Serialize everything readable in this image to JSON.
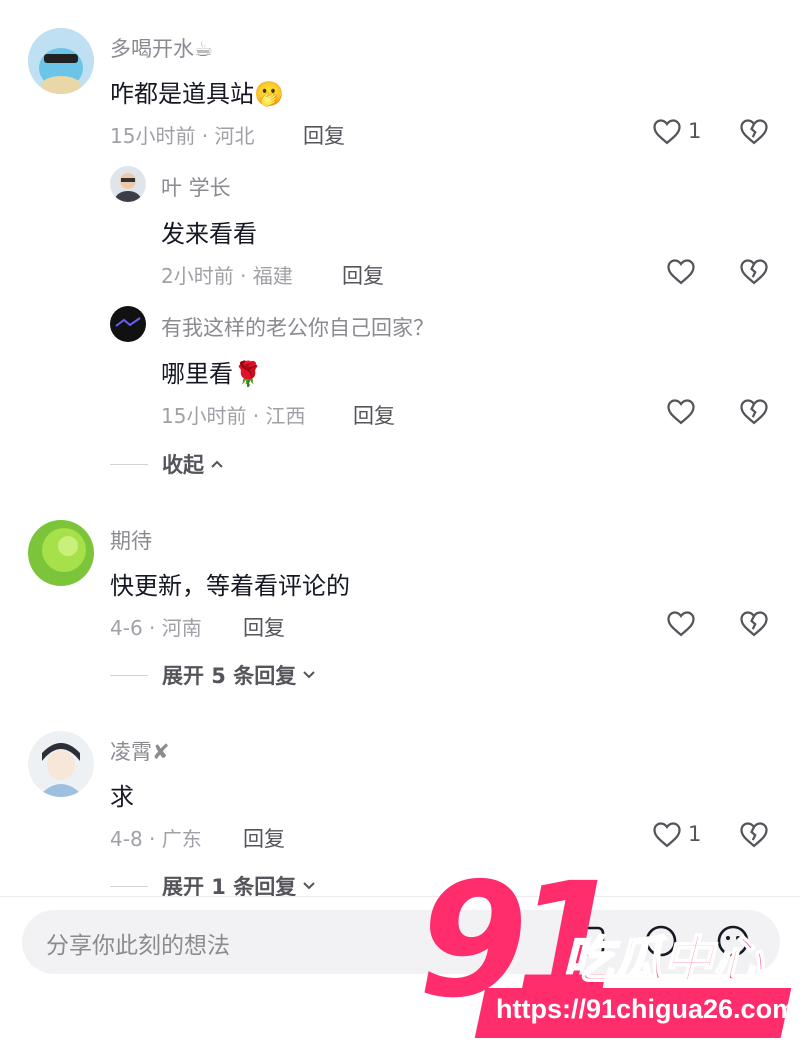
{
  "comments": [
    {
      "username": "多喝开水☕",
      "text": "咋都是道具站🫢",
      "time_location": "15小时前 · 河北",
      "reply_label": "回复",
      "like_count": "1",
      "replies": [
        {
          "username": "叶 学长",
          "text": "发来看看",
          "time_location": "2小时前 · 福建",
          "reply_label": "回复"
        },
        {
          "username": "有我这样的老公你自己回家？",
          "text": "哪里看🌹",
          "time_location": "15小时前 · 江西",
          "reply_label": "回复"
        }
      ],
      "collapse_label": "收起"
    },
    {
      "username": "期待",
      "text": "快更新，等着看评论的",
      "time_location": "4-6 · 河南",
      "reply_label": "回复",
      "expand_label": "展开 5 条回复"
    },
    {
      "username": "凌霄✘",
      "text": "求",
      "time_location": "4-8 · 广东",
      "reply_label": "回复",
      "like_count": "1",
      "expand_label": "展开 1 条回复"
    }
  ],
  "input": {
    "placeholder": "分享你此刻的想法"
  },
  "watermark": {
    "number": "91",
    "brand": "吃瓜中心",
    "url": "https://91chigua26.com"
  },
  "colors": {
    "accent": "#ff2d6c",
    "text": "#161823",
    "meta": "#a0a1a6"
  }
}
